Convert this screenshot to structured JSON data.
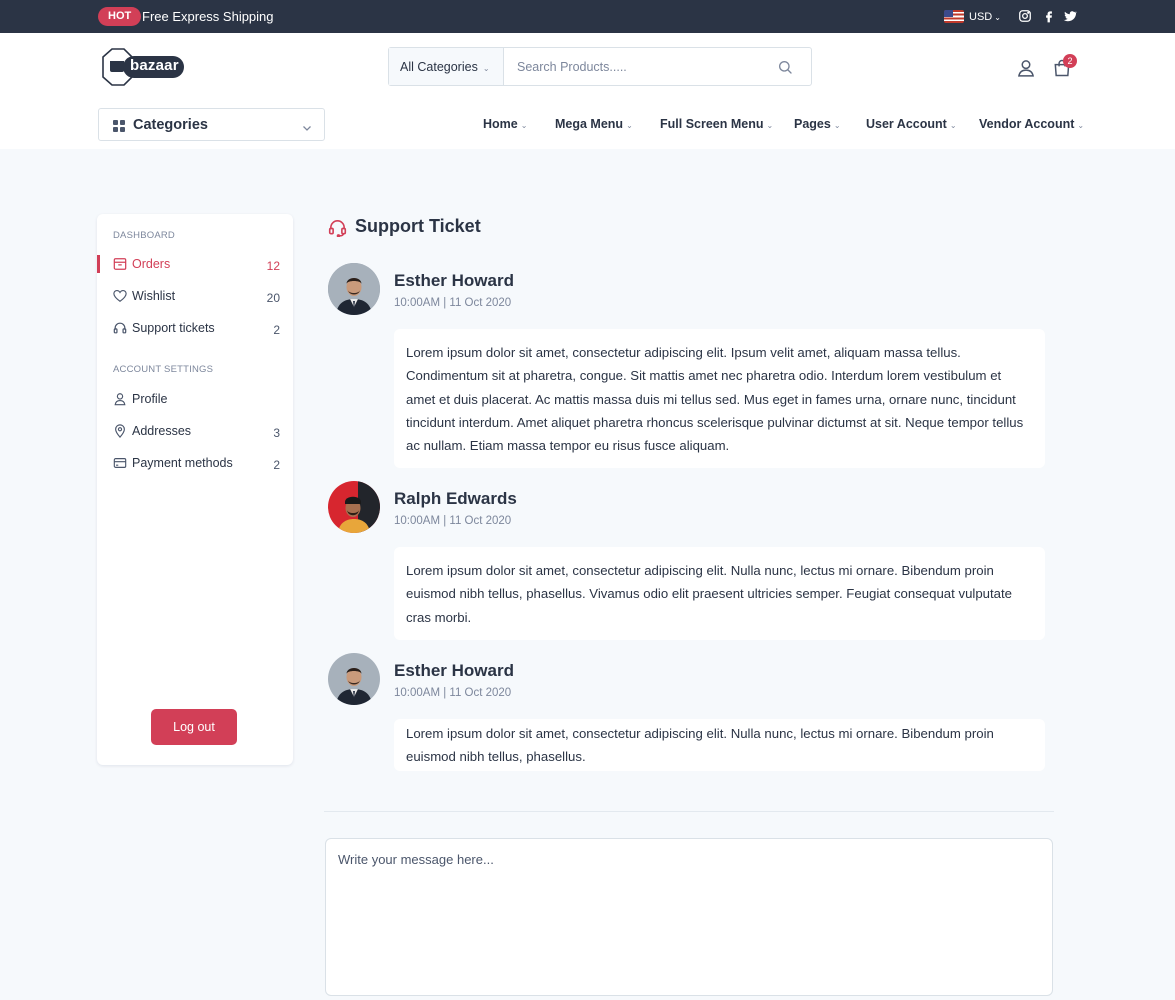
{
  "topbar": {
    "badge": "HOT",
    "promo": "Free Express Shipping",
    "currency": "USD",
    "currency_caret": "⌄"
  },
  "header": {
    "logo_text": "bazaar",
    "search": {
      "category": "All Categories",
      "caret": "⌄",
      "placeholder": "Search Products....."
    },
    "cart_count": "2"
  },
  "nav": {
    "categories_label": "Categories",
    "caret": "⌄",
    "items": [
      {
        "label": "Home"
      },
      {
        "label": "Mega Menu"
      },
      {
        "label": "Full Screen Menu"
      },
      {
        "label": "Pages"
      },
      {
        "label": "User Account"
      },
      {
        "label": "Vendor Account"
      }
    ]
  },
  "sidebar": {
    "sections": [
      {
        "title": "DASHBOARD"
      },
      {
        "title": "ACCOUNT SETTINGS"
      }
    ],
    "items": [
      {
        "label": "Orders",
        "count": "12",
        "icon": "orders-icon",
        "active": true
      },
      {
        "label": "Wishlist",
        "count": "20",
        "icon": "heart-icon"
      },
      {
        "label": "Support tickets",
        "count": "2",
        "icon": "headset-icon"
      },
      {
        "label": "Profile",
        "count": "",
        "icon": "user-icon"
      },
      {
        "label": "Addresses",
        "count": "3",
        "icon": "location-pin-icon"
      },
      {
        "label": "Payment methods",
        "count": "2",
        "icon": "credit-card-icon"
      }
    ],
    "logout_label": "Log out"
  },
  "main": {
    "title": "Support Ticket",
    "messages": [
      {
        "name": "Esther Howard",
        "time": "10:00AM | 11 Oct 2020",
        "text": "Lorem ipsum dolor sit amet, consectetur adipiscing elit. Ipsum velit amet, aliquam massa tellus. Condimentum sit at pharetra, congue. Sit mattis amet nec pharetra odio. Interdum lorem vestibulum et amet et duis placerat. Ac mattis massa duis mi tellus sed. Mus eget in fames urna, ornare nunc, tincidunt tincidunt interdum. Amet aliquet pharetra rhoncus scelerisque pulvinar dictumst at sit. Neque tempor tellus ac nullam. Etiam massa tempor eu risus fusce aliquam."
      },
      {
        "name": "Ralph Edwards",
        "time": "10:00AM | 11 Oct 2020",
        "text": "Lorem ipsum dolor sit amet, consectetur adipiscing elit. Nulla nunc, lectus mi ornare. Bibendum proin euismod nibh tellus, phasellus. Vivamus odio elit praesent ultricies semper. Feugiat consequat vulputate cras morbi."
      },
      {
        "name": "Esther Howard",
        "time": "10:00AM | 11 Oct 2020",
        "text": "Lorem ipsum dolor sit amet, consectetur adipiscing elit. Nulla nunc, lectus mi ornare. Bibendum proin euismod nibh tellus, phasellus."
      }
    ],
    "message_placeholder": "Write your message here..."
  },
  "colors": {
    "primary": "#d23f57",
    "dark": "#2b3445",
    "background": "#f6f9fc"
  }
}
